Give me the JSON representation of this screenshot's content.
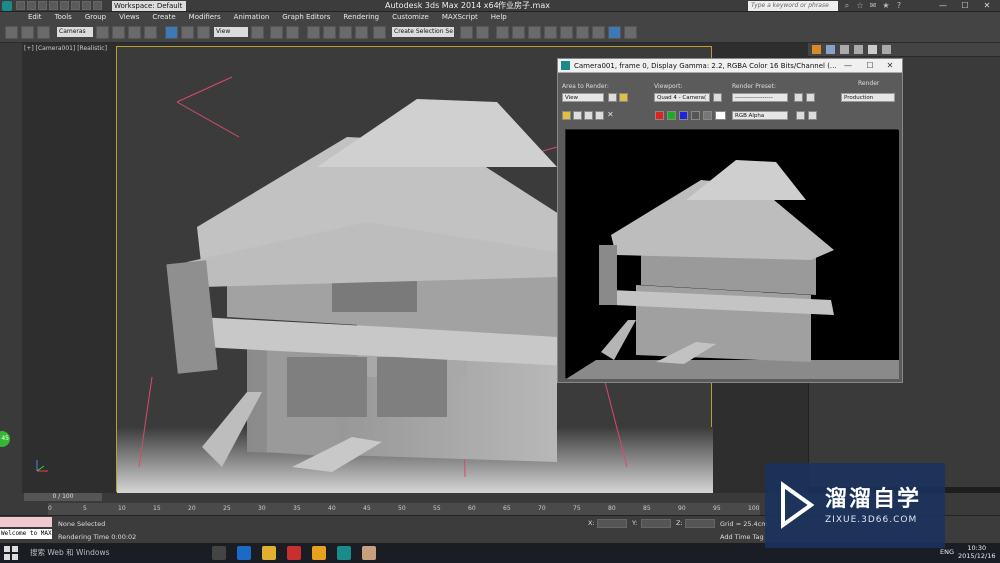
{
  "titlebar": {
    "app_title": "Autodesk 3ds Max  2014 x64",
    "file_title": "作业房子.max",
    "workspace": "Workspace: Default",
    "search_placeholder": "Type a keyword or phrase"
  },
  "menu": [
    "Edit",
    "Tools",
    "Group",
    "Views",
    "Create",
    "Modifiers",
    "Animation",
    "Graph Editors",
    "Rendering",
    "Customize",
    "MAXScript",
    "Help"
  ],
  "toolbar": {
    "filter": "Cameras",
    "ref_coord": "View",
    "selection_set": "Create Selection Se"
  },
  "viewport": {
    "label": "[+] [Camera001] [Realistic]"
  },
  "render_window": {
    "title": "Camera001, frame 0, Display Gamma: 2.2, RGBA Color 16 Bits/Channel (...",
    "area_label": "Area to Render:",
    "area_value": "View",
    "viewport_label": "Viewport:",
    "viewport_value": "Quad 4 - Camera(",
    "preset_label": "Render Preset:",
    "preset_value": "-------------------",
    "render_button": "Render",
    "production_value": "Production",
    "channel_value": "RGB Alpha"
  },
  "timeline": {
    "slider": "0 / 100",
    "ticks": [
      "0",
      "5",
      "10",
      "15",
      "20",
      "25",
      "30",
      "35",
      "40",
      "45",
      "50",
      "55",
      "60",
      "65",
      "70",
      "75",
      "80",
      "85",
      "90",
      "95",
      "100"
    ]
  },
  "statusbar": {
    "maxscript_line2": "Welcome to MAX",
    "selection": "None Selected",
    "render_time": "Rendering Time  0:00:02",
    "x_label": "X:",
    "y_label": "Y:",
    "z_label": "Z:",
    "grid": "Grid = 25.4cm",
    "add_time_tag": "Add Time Tag"
  },
  "taskbar": {
    "search": "搜索 Web 和 Windows",
    "lang": "ENG",
    "time": "10:30",
    "date": "2015/12/16"
  },
  "watermark": {
    "main": "溜溜自学",
    "sub": "ZIXUE.3D66.COM"
  },
  "green_badge": "45",
  "colors": {
    "accent": "#3e78b5",
    "safe_frame": "#b8a030",
    "watermark_bg": "#19325f"
  }
}
